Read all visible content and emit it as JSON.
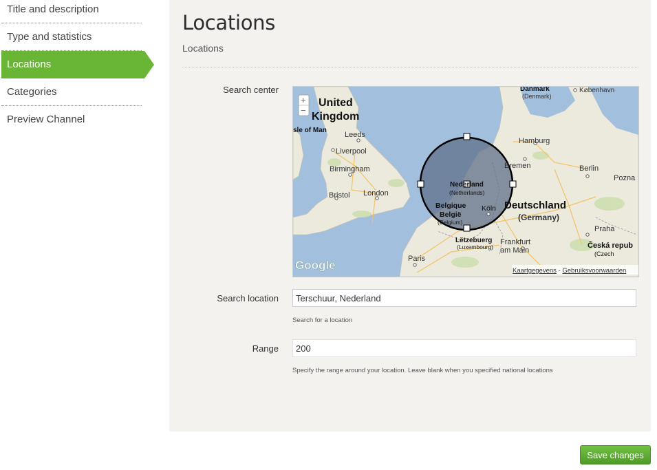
{
  "sidebar": {
    "items": [
      {
        "label": "Title and description"
      },
      {
        "label": "Type and statistics"
      },
      {
        "label": "Locations",
        "active": true
      },
      {
        "label": "Categories"
      },
      {
        "label": "Preview Channel"
      }
    ]
  },
  "main": {
    "title": "Locations",
    "subtitle": "Locations"
  },
  "form": {
    "search_center_label": "Search center",
    "search_location_label": "Search location",
    "search_location_value": "Terschuur, Nederland",
    "search_location_help": "Search for a location",
    "range_label": "Range",
    "range_value": "200",
    "range_help": "Specify the range around your location. Leave blank when you specified national locations"
  },
  "map": {
    "zoom_in": "+",
    "zoom_out": "−",
    "attribution_data": "Kaartgegevens",
    "attribution_sep": " - ",
    "attribution_terms": "Gebruiksvoorwaarden",
    "logo": "Google",
    "labels": {
      "uk1": "United",
      "uk2": "Kingdom",
      "iom": "sle of Man",
      "leeds": "Leeds",
      "liverpool": "Liverpool",
      "birmingham": "Birmingham",
      "bristol": "Bristol",
      "london": "London",
      "paris": "Paris",
      "danmark": "Danmark",
      "denmark": "(Denmark)",
      "kobenhavn": "København",
      "hamburg": "Hamburg",
      "bremen": "Bremen",
      "berlin": "Berlin",
      "poznan": "Pozna",
      "nederland": "Nederland",
      "netherlands": "(Netherlands)",
      "belgique": "Belgique",
      "belgie": "België",
      "belgium": "(Belgium)",
      "koln": "Köln",
      "deutschland": "Deutschland",
      "germany": "(Germany)",
      "letzebuerg": "Lëtzebuerg",
      "luxembourg": "(Luxembourg)",
      "frankfurt1": "Frankfurt",
      "frankfurt2": "am Main",
      "praha": "Praha",
      "ceska": "Česká repub",
      "czech": "(Czech"
    }
  },
  "colors": {
    "accent": "#69b535",
    "panel_bg": "#f3f2ef",
    "water": "#a3bfde",
    "land": "#ece9dd",
    "circle_fill": "#60708a"
  },
  "actions": {
    "save_label": "Save changes"
  }
}
